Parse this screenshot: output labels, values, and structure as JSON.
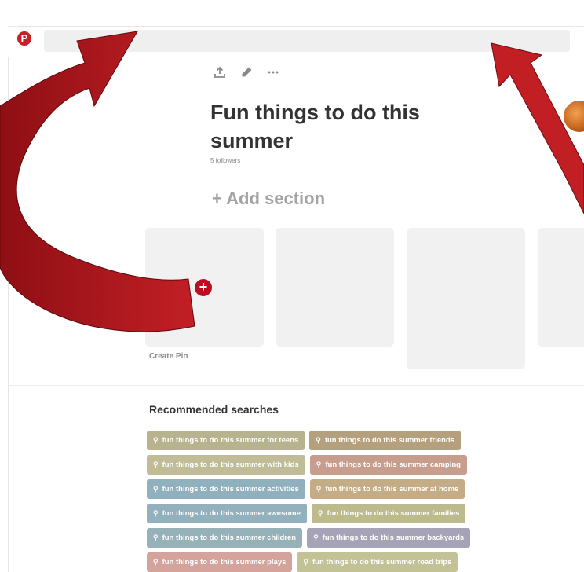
{
  "app": {
    "logo_letter": "P",
    "brand_color": "#cb1f27"
  },
  "board": {
    "title": "Fun things to do this summer",
    "followers": "5 followers",
    "add_section": "+ Add section",
    "actions": [
      "share-icon",
      "edit-icon",
      "more-icon"
    ]
  },
  "pins": {
    "create_label": "Create Pin"
  },
  "recommended": {
    "heading": "Recommended searches",
    "rows": [
      [
        {
          "label": "fun things to do this summer for teens",
          "color": "#b8b38f"
        },
        {
          "label": "fun things to do this summer friends",
          "color": "#b5a07e"
        }
      ],
      [
        {
          "label": "fun things to do this summer with kids",
          "color": "#c0bc98"
        },
        {
          "label": "fun things to do this summer camping",
          "color": "#c79e8d"
        }
      ],
      [
        {
          "label": "fun things to do this summer activities",
          "color": "#8fb0bc"
        },
        {
          "label": "fun things to do this summer at home",
          "color": "#c4ac86"
        }
      ],
      [
        {
          "label": "fun things to do this summer awesome",
          "color": "#93b1bc"
        },
        {
          "label": "fun things to do this summer families",
          "color": "#bdbb8d"
        }
      ],
      [
        {
          "label": "fun things to do this summer children",
          "color": "#96b2b8"
        },
        {
          "label": "fun things to do this summer backyards",
          "color": "#a7a3b7"
        }
      ],
      [
        {
          "label": "fun things to do this summer plays",
          "color": "#d4a39b"
        },
        {
          "label": "fun things to do this summer road trips",
          "color": "#c3c196"
        }
      ]
    ]
  },
  "overlay_color": "#c21f25"
}
